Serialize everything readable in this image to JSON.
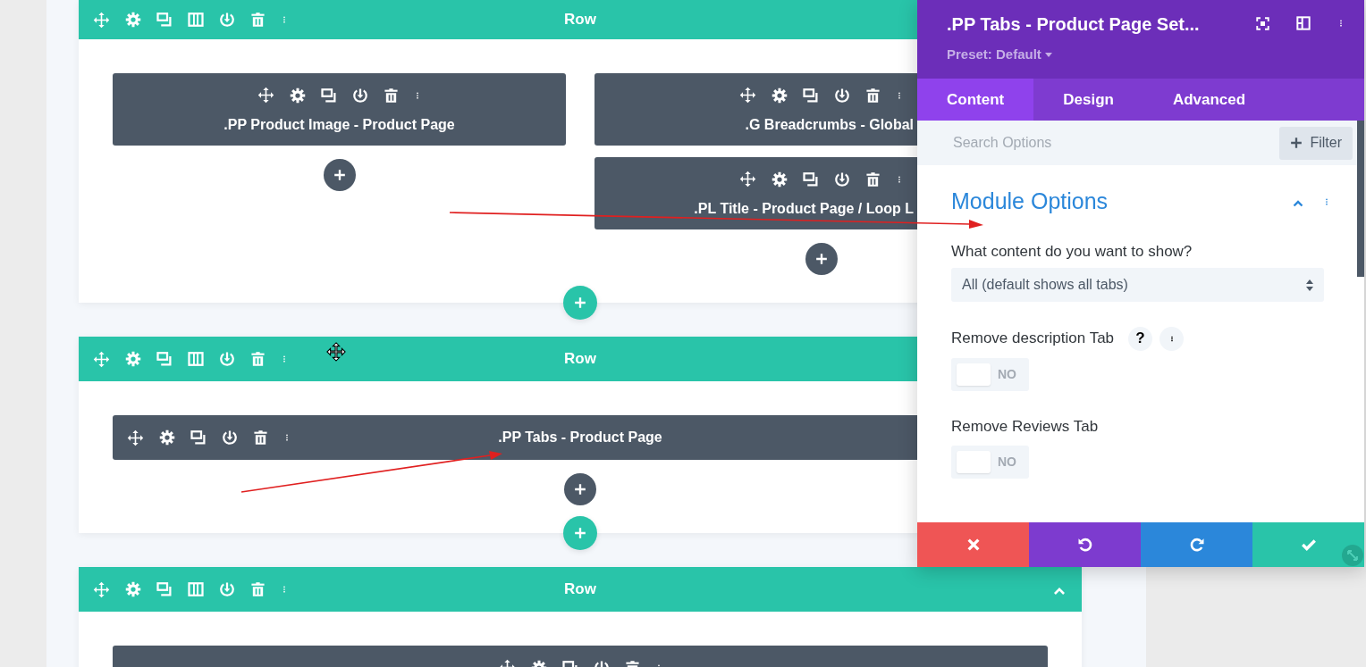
{
  "rows": [
    {
      "title": "Row",
      "columns": [
        {
          "modules": [
            {
              "kind": "stacked",
              "title": ".PP Product Image - Product Page"
            }
          ]
        },
        {
          "modules": [
            {
              "kind": "stacked",
              "title": ".G Breadcrumbs - Global"
            },
            {
              "kind": "stacked",
              "title": ".PL Title - Product Page / Loop L"
            }
          ]
        }
      ]
    },
    {
      "title": "Row",
      "columns": [
        {
          "modules": [
            {
              "kind": "inline",
              "title": ".PP Tabs - Product Page"
            }
          ]
        }
      ]
    },
    {
      "title": "Row",
      "columns": [
        {
          "modules": [
            {
              "kind": "stacked"
            }
          ]
        }
      ]
    }
  ],
  "settings_panel": {
    "title": ".PP Tabs - Product Page Set...",
    "preset": "Preset: Default",
    "tabs": [
      {
        "label": "Content",
        "selected": true
      },
      {
        "label": "Design",
        "selected": false
      },
      {
        "label": "Advanced",
        "selected": false
      }
    ],
    "search": {
      "placeholder": "Search Options"
    },
    "filter_button": "Filter",
    "section": {
      "title": "Module Options",
      "expanded": true
    },
    "fields": [
      {
        "kind": "select",
        "label": "What content do you want to show?",
        "value": "All (default shows all tabs)"
      },
      {
        "kind": "toggle",
        "label": "Remove description Tab",
        "help": "?",
        "on": false,
        "state_text": "NO"
      },
      {
        "kind": "toggle",
        "label": "Remove Reviews Tab",
        "on": false,
        "state_text": "NO"
      }
    ]
  }
}
